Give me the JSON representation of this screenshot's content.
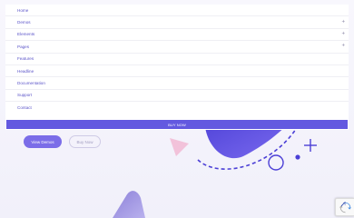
{
  "menu": {
    "items": [
      {
        "label": "Home",
        "has_submenu": false
      },
      {
        "label": "Demos",
        "has_submenu": true
      },
      {
        "label": "Elements",
        "has_submenu": true
      },
      {
        "label": "Pages",
        "has_submenu": true
      },
      {
        "label": "Features",
        "has_submenu": false
      },
      {
        "label": "Headline",
        "has_submenu": false
      },
      {
        "label": "Documentation",
        "has_submenu": false
      },
      {
        "label": "Support",
        "has_submenu": false
      },
      {
        "label": "Contact",
        "has_submenu": false
      }
    ],
    "expand_symbol": "+",
    "buy_label": "BUY NOW"
  },
  "hero": {
    "primary_button": "View Demos",
    "secondary_button": "Buy Now"
  },
  "colors": {
    "accent": "#6359e0",
    "menu_text": "#5b54c9",
    "hero_bg": "#f4f3fb",
    "button_primary": "#7b6de8"
  },
  "icons": [
    "plus-icon",
    "recaptcha-icon"
  ]
}
